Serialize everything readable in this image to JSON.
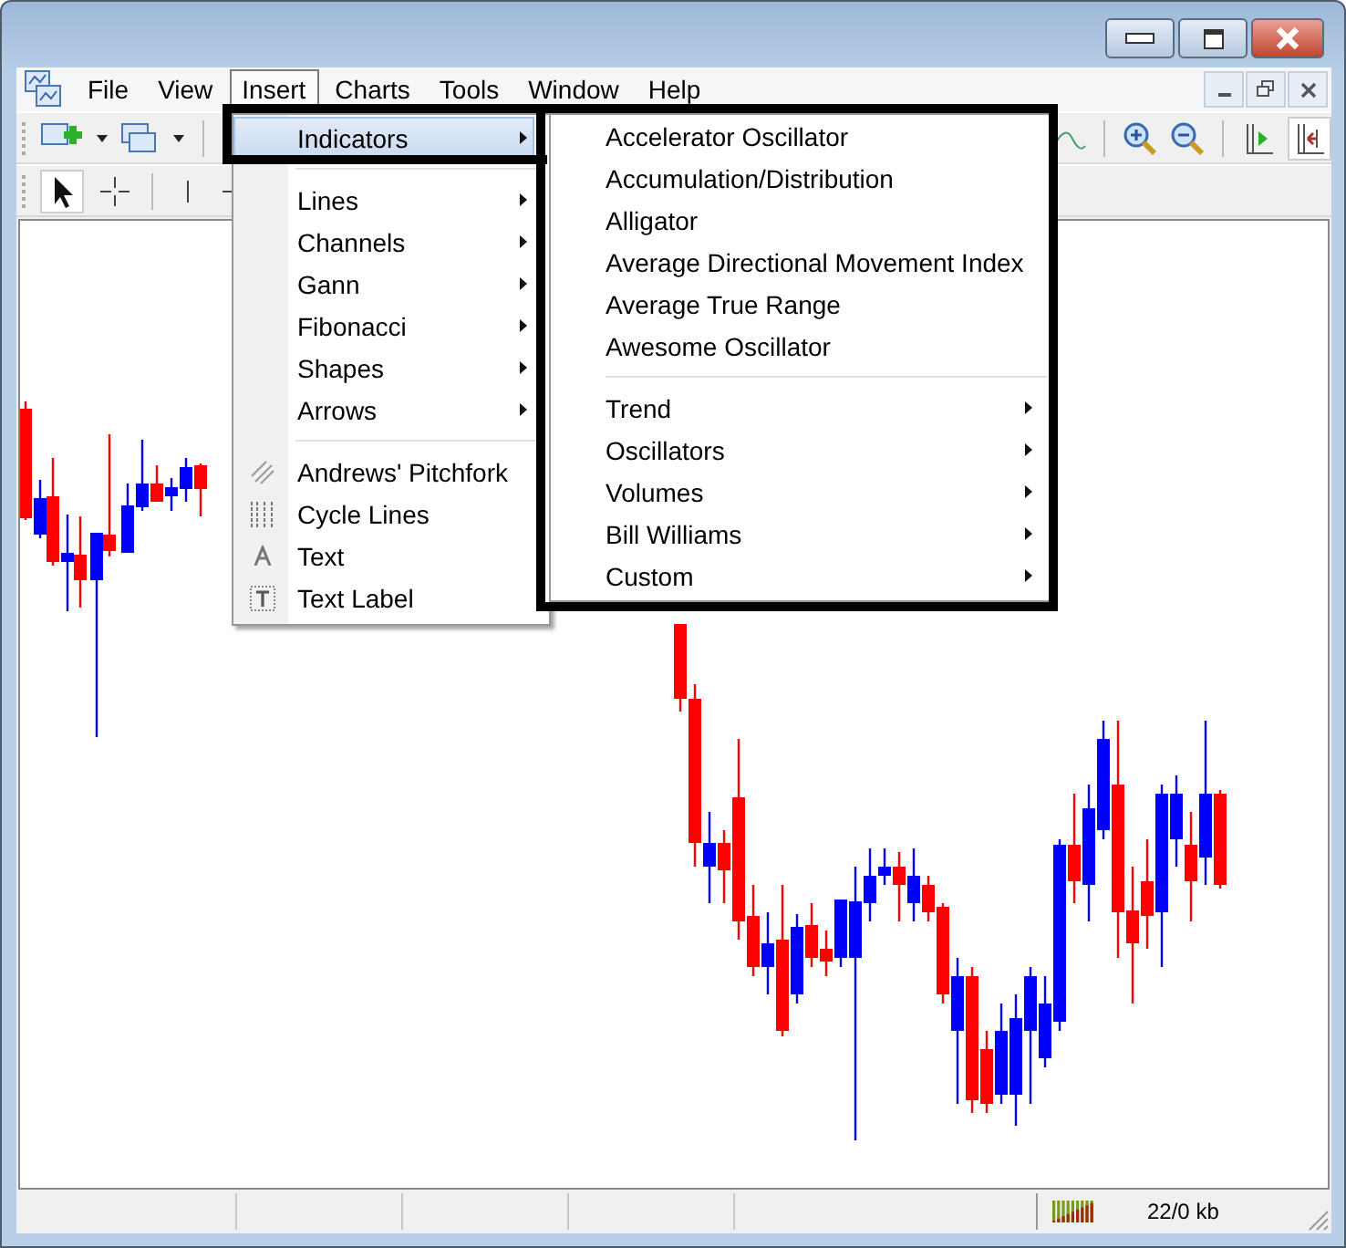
{
  "menubar": [
    {
      "label": "File",
      "selected": false
    },
    {
      "label": "View",
      "selected": false
    },
    {
      "label": "Insert",
      "selected": true
    },
    {
      "label": "Charts",
      "selected": false
    },
    {
      "label": "Tools",
      "selected": false
    },
    {
      "label": "Window",
      "selected": false
    },
    {
      "label": "Help",
      "selected": false
    }
  ],
  "insert_menu": {
    "groups": [
      [
        {
          "label": "Indicators",
          "kind": "submenu",
          "selected": true
        }
      ],
      [
        {
          "label": "Lines",
          "kind": "submenu",
          "selected": false
        },
        {
          "label": "Channels",
          "kind": "submenu",
          "selected": false
        },
        {
          "label": "Gann",
          "kind": "submenu",
          "selected": false
        },
        {
          "label": "Fibonacci",
          "kind": "submenu",
          "selected": false
        },
        {
          "label": "Shapes",
          "kind": "submenu",
          "selected": false
        },
        {
          "label": "Arrows",
          "kind": "submenu",
          "selected": false
        }
      ],
      [
        {
          "label": "Andrews' Pitchfork",
          "kind": "pitchfork",
          "selected": false
        },
        {
          "label": "Cycle Lines",
          "kind": "cycle",
          "selected": false
        },
        {
          "label": "Text",
          "kind": "text",
          "selected": false
        },
        {
          "label": "Text Label",
          "kind": "label",
          "selected": false
        }
      ]
    ]
  },
  "indicators_submenu": {
    "groups": [
      [
        {
          "label": "Accelerator Oscillator",
          "kind": "command"
        },
        {
          "label": "Accumulation/Distribution",
          "kind": "command"
        },
        {
          "label": "Alligator",
          "kind": "command"
        },
        {
          "label": "Average Directional Movement Index",
          "kind": "command"
        },
        {
          "label": "Average True Range",
          "kind": "command"
        },
        {
          "label": "Awesome Oscillator",
          "kind": "command"
        }
      ],
      [
        {
          "label": "Trend",
          "kind": "submenu"
        },
        {
          "label": "Oscillators",
          "kind": "submenu"
        },
        {
          "label": "Volumes",
          "kind": "submenu"
        },
        {
          "label": "Bill Williams",
          "kind": "submenu"
        },
        {
          "label": "Custom",
          "kind": "submenu"
        }
      ]
    ]
  },
  "status_bar": {
    "traffic": "22/0 kb"
  }
}
